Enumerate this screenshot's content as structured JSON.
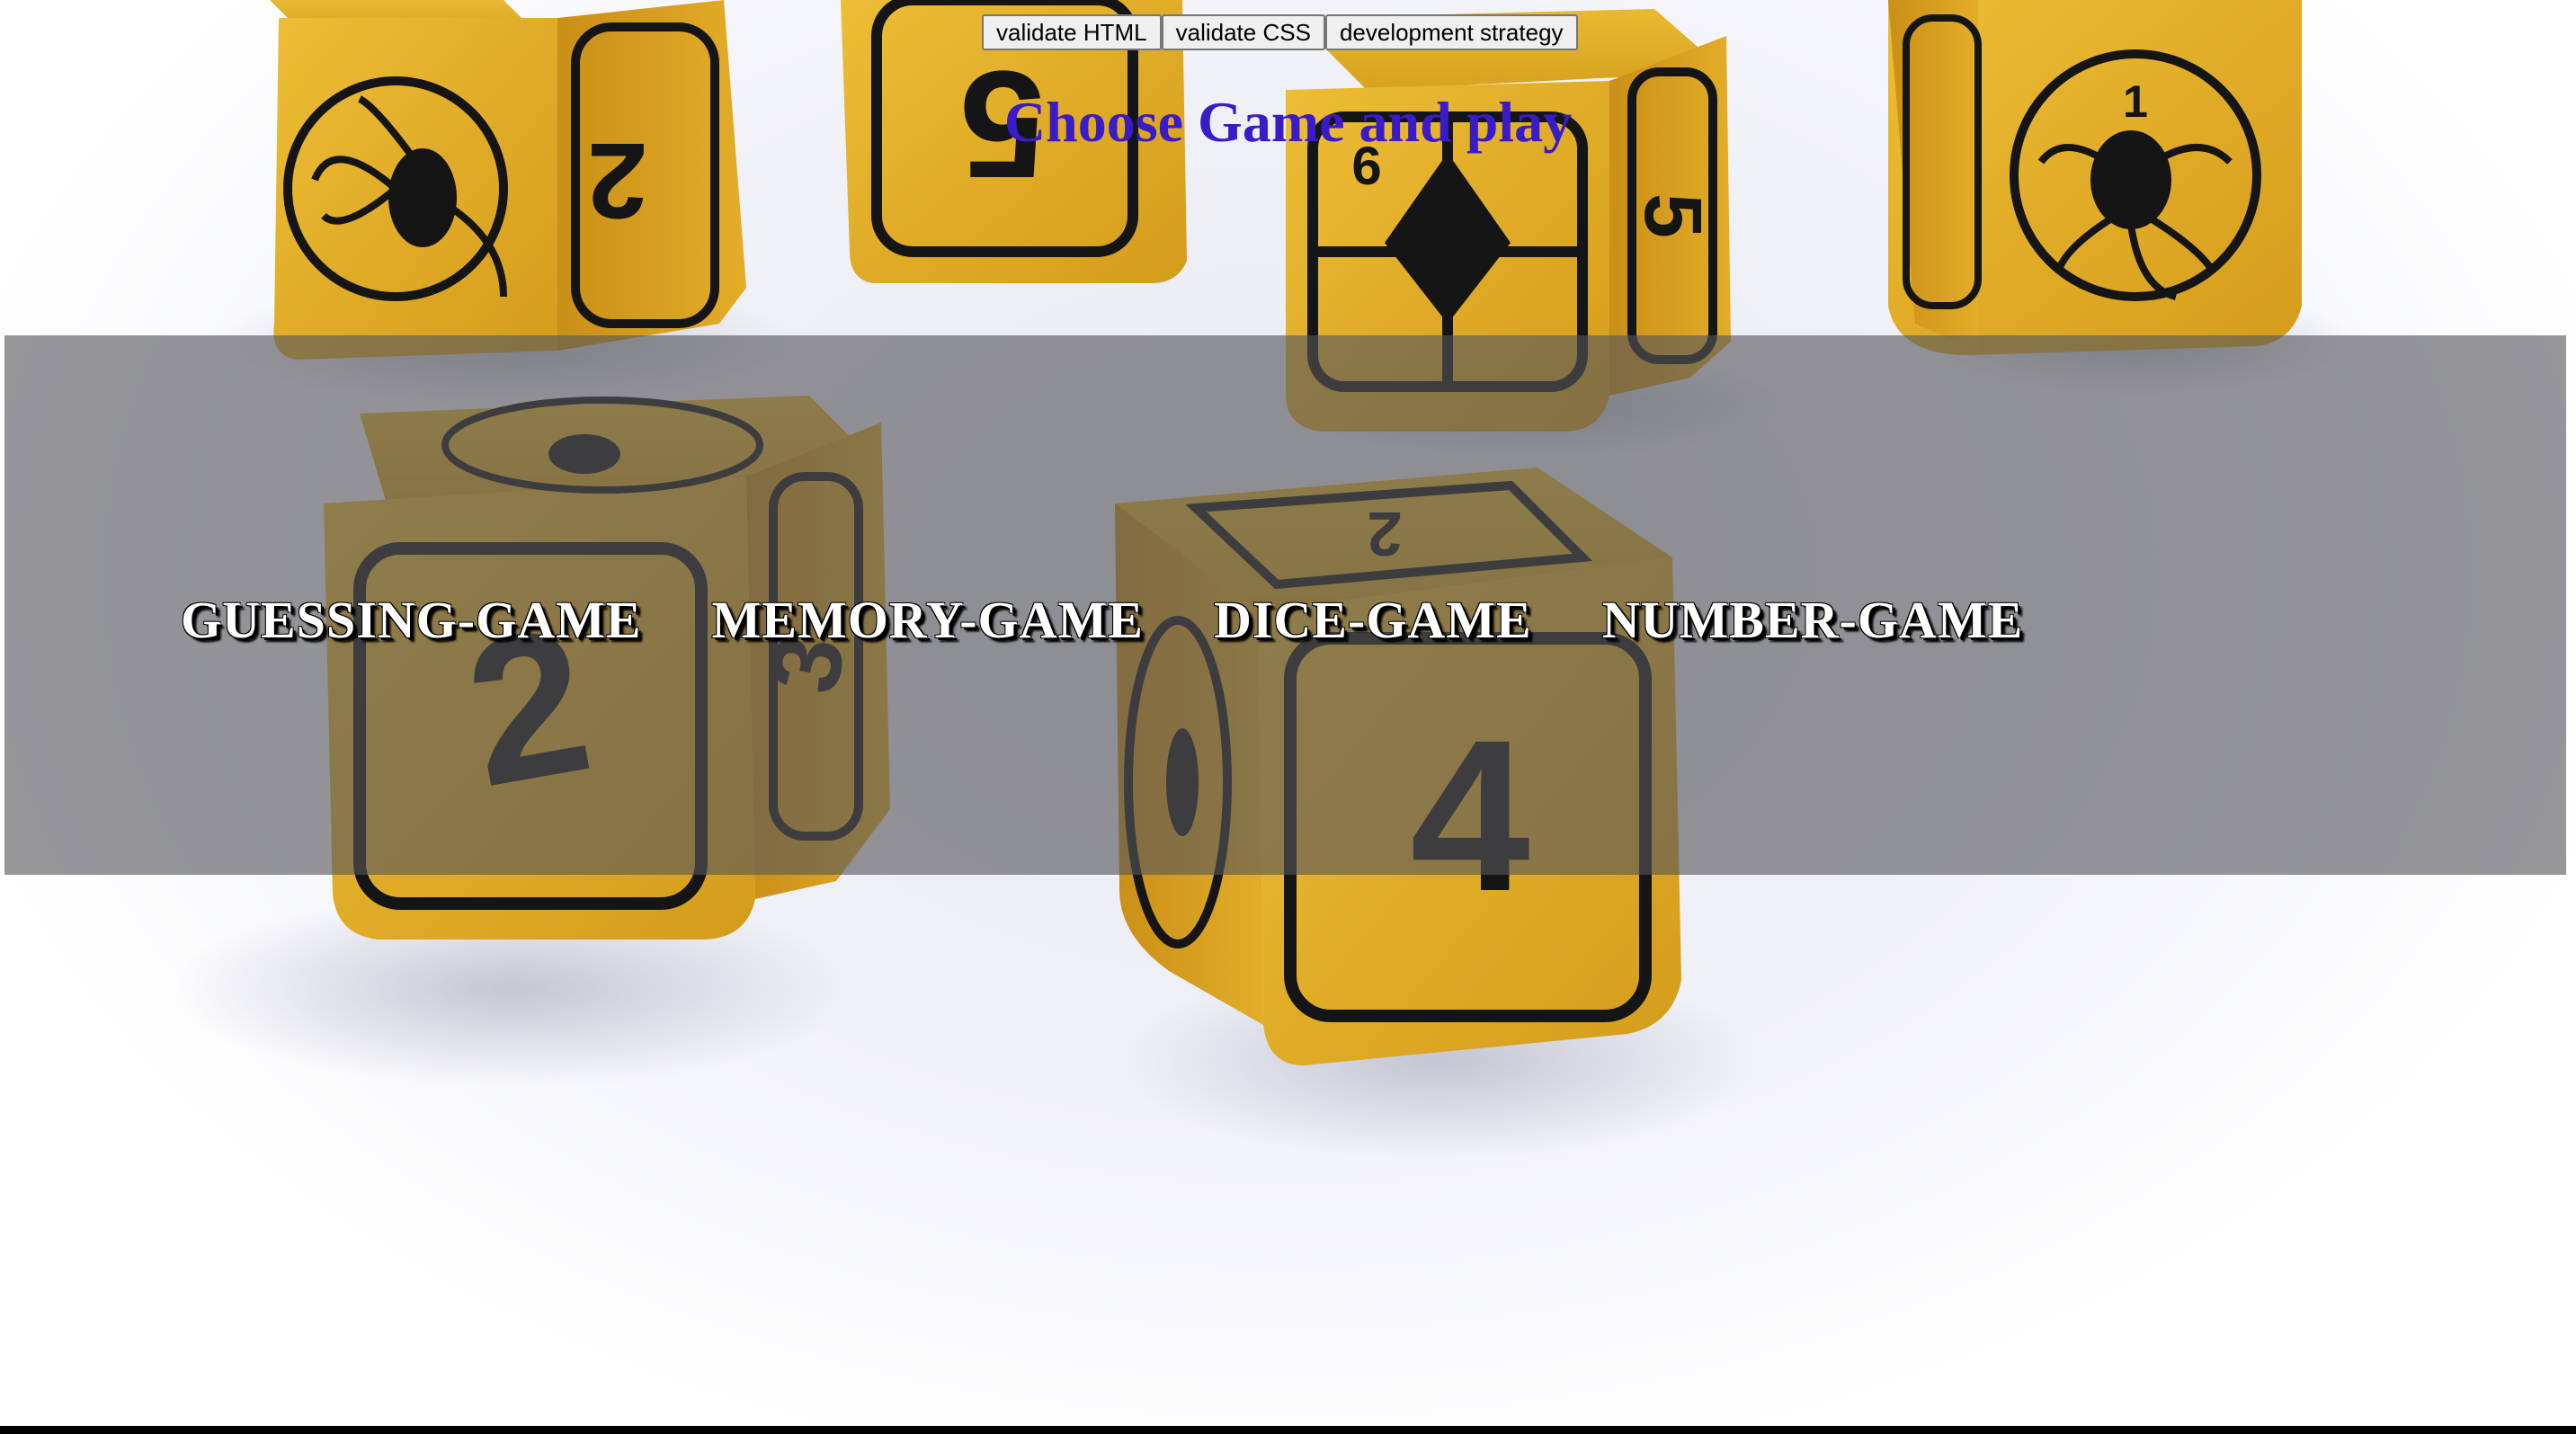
{
  "toolbar": {
    "validate_html_label": "validate HTML",
    "validate_css_label": "validate CSS",
    "development_strategy_label": "development strategy"
  },
  "header": {
    "title": "Choose Game and play"
  },
  "games": [
    {
      "label": "GUESSING-GAME"
    },
    {
      "label": "MEMORY-GAME"
    },
    {
      "label": "DICE-GAME"
    },
    {
      "label": "NUMBER-GAME"
    }
  ],
  "background": {
    "image": "yellow-dice-photo",
    "die_color": "#d9a521",
    "die_symbol_color": "#151515"
  },
  "colors": {
    "title": "#3a1bc8",
    "panel_overlay": "#55555a",
    "game_text": "#ffffff",
    "game_shadow": "#000000",
    "footer_bar": "#000000"
  }
}
